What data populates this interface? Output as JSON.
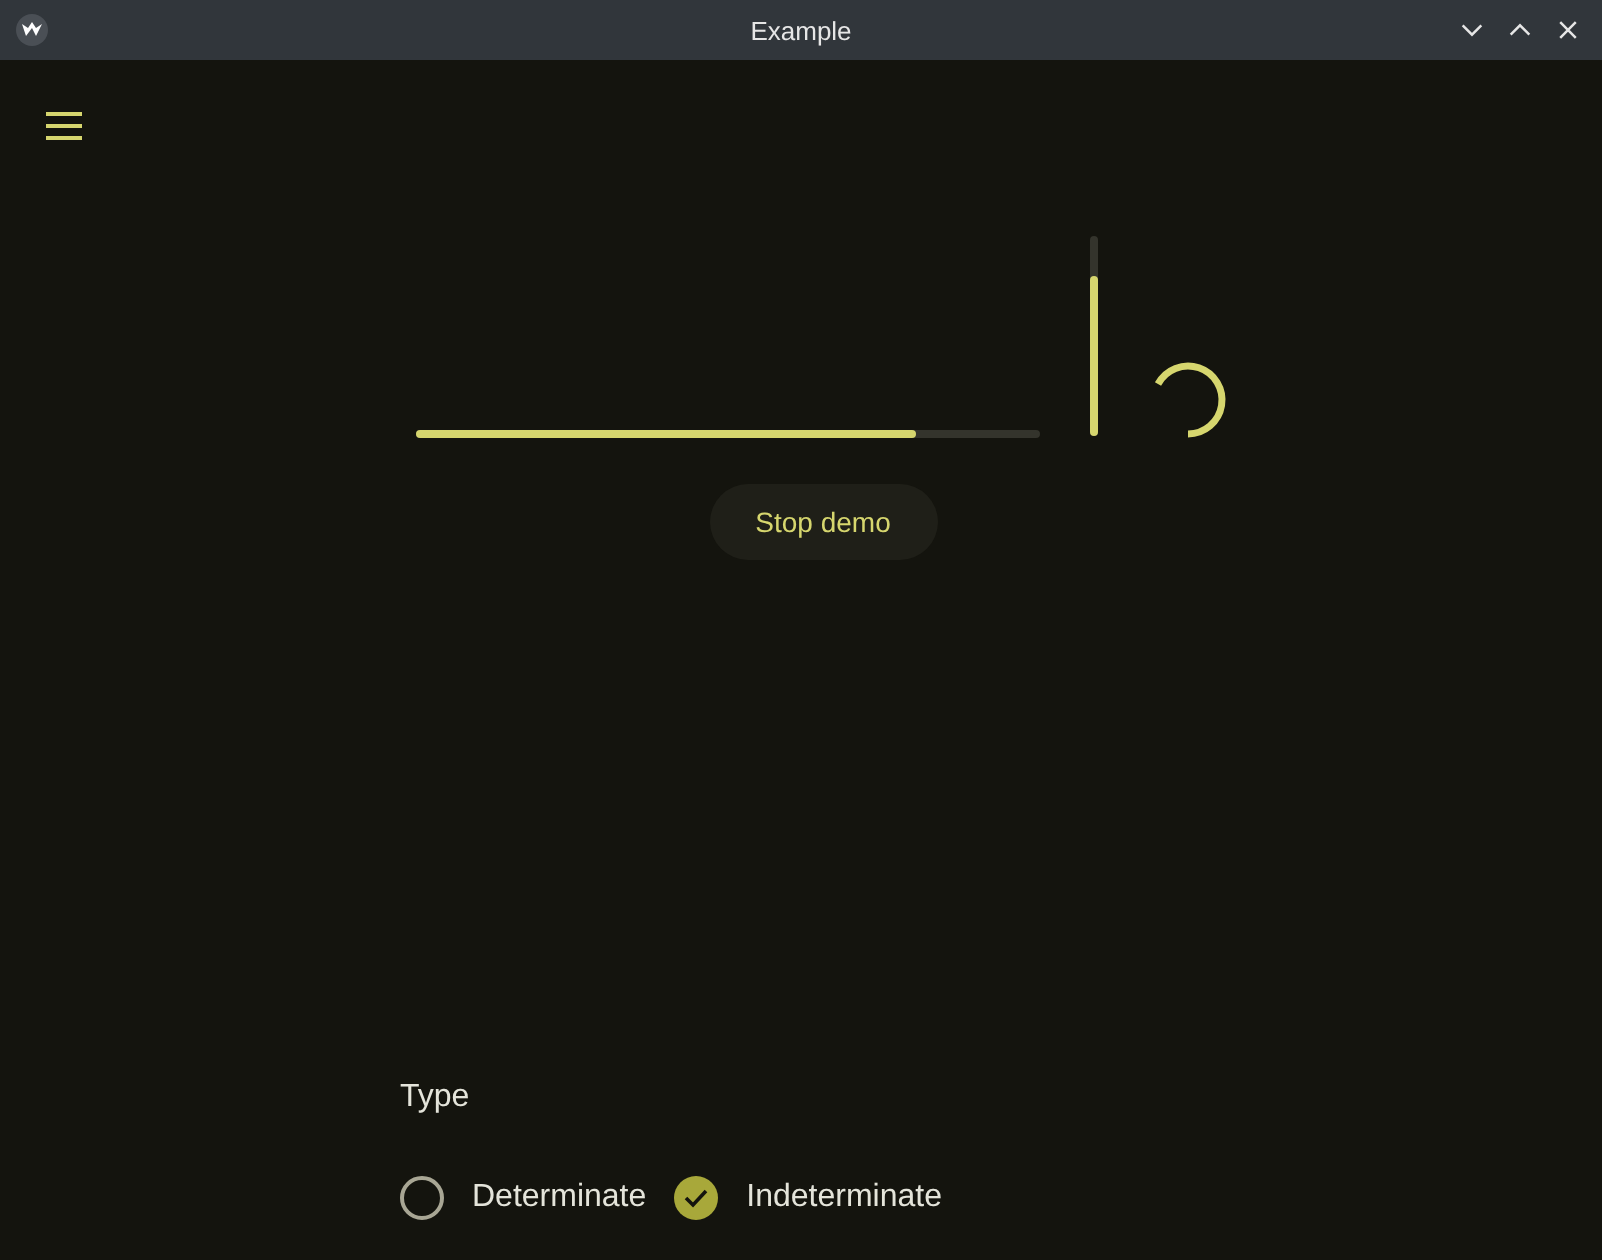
{
  "window": {
    "title": "Example",
    "buttons": [
      {
        "kind": "minimize"
      },
      {
        "kind": "maximize"
      },
      {
        "kind": "close"
      }
    ]
  },
  "progress": {
    "horizontal": {
      "level": 0.8
    },
    "vertical": {
      "level": 0.8
    }
  },
  "button": {
    "label": "Stop demo"
  },
  "type_group": {
    "label": "Type",
    "options": [
      {
        "label": "Determinate",
        "selected": false
      },
      {
        "label": "Indeterminate",
        "selected": true
      }
    ]
  }
}
